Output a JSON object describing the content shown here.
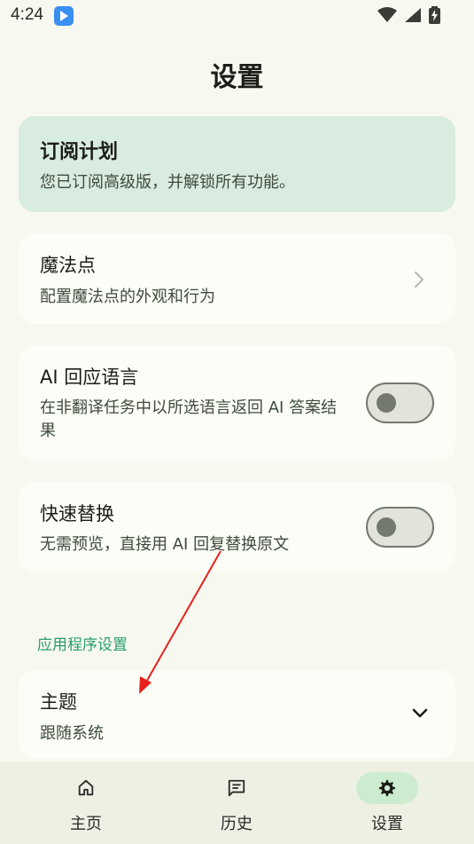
{
  "status_bar": {
    "time": "4:24"
  },
  "page": {
    "title": "设置"
  },
  "subscription": {
    "title": "订阅计划",
    "description": "您已订阅高级版，并解锁所有功能。"
  },
  "magic_dot": {
    "title": "魔法点",
    "description": "配置魔法点的外观和行为"
  },
  "ai_language": {
    "title": "AI 回应语言",
    "description": "在非翻译任务中以所选语言返回 AI 答案结果",
    "enabled": false
  },
  "quick_replace": {
    "title": "快速替换",
    "description": "无需预览，直接用 AI 回复替换原文",
    "enabled": false
  },
  "app_settings": {
    "section_label": "应用程序设置"
  },
  "theme": {
    "title": "主题",
    "value": "跟随系统"
  },
  "bottom_nav": {
    "items": [
      {
        "label": "主页",
        "icon": "home-icon",
        "active": false
      },
      {
        "label": "历史",
        "icon": "history-icon",
        "active": false
      },
      {
        "label": "设置",
        "icon": "gear-icon",
        "active": true
      }
    ]
  },
  "colors": {
    "background": "#f7f9f0",
    "subscription_card": "#d8ecdf",
    "section_accent": "#2a9d6f",
    "nav_active": "#cdeccf",
    "annotation_arrow": "#e8221b"
  }
}
